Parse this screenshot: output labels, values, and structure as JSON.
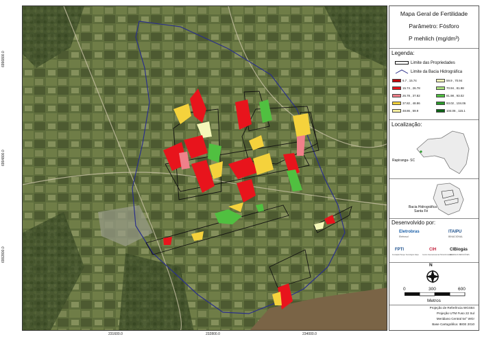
{
  "title": {
    "line1": "Mapa Geral de Fertilidade",
    "line2": "Parâmetro: Fósforo",
    "line3": "P mehlich (mg/dm³)"
  },
  "axes": {
    "y_ticks": [
      "6996800.0",
      "6994800.0",
      "6992800.0"
    ],
    "x_ticks": [
      "231600.0",
      "232800.0",
      "234000.0"
    ]
  },
  "legend": {
    "heading": "Legenda:",
    "property_limit": "Limite das Propriedades",
    "basin_limit": "Limite da Bacia Hidrográfica",
    "classes": [
      {
        "label": "6.7 , 15.74",
        "color": "#c0000a"
      },
      {
        "label": "15.74 , 26.78",
        "color": "#e8141c"
      },
      {
        "label": "26.78 , 37.82",
        "color": "#f0808a"
      },
      {
        "label": "37.82 , 48.86",
        "color": "#f5d23c"
      },
      {
        "label": "48.86 , 59.9",
        "color": "#f7f0a0"
      },
      {
        "label": "59.9 , 70.94",
        "color": "#f4f7b8"
      },
      {
        "label": "70.94 , 81.98",
        "color": "#a8e07c"
      },
      {
        "label": "81.98 , 93.02",
        "color": "#50c040"
      },
      {
        "label": "93.02 , 104.06",
        "color": "#2a9a2a"
      },
      {
        "label": "104.06 , 115.1",
        "color": "#0e6418"
      }
    ]
  },
  "location": {
    "heading": "Localização:",
    "city": "Rapiranga- SC"
  },
  "basin": {
    "label_line1": "Bacia Hidrográfica",
    "label_line2": "Santa Fé"
  },
  "developed_by": {
    "heading": "Desenvolvido por:",
    "logos": [
      {
        "name": "Eletrobras",
        "sub": "Eletrosul",
        "color": "#1a5fa8"
      },
      {
        "name": "ITAIPU",
        "sub": "BINACIONAL",
        "color": "#1b4f8c"
      },
      {
        "name": "FPTI",
        "sub": "Fundação Parque Tecnológico Itaipu",
        "color": "#1b4f8c"
      },
      {
        "name": "CIH",
        "sub": "Centro Internacional de Hidroinformática",
        "color": "#c21e3a"
      },
      {
        "name": "CIBiogás",
        "sub": "ENERGIAS RENOVÁVEIS",
        "color": "#1b1b1b"
      }
    ]
  },
  "scale": {
    "north": "N",
    "v0": "0",
    "v1": "300",
    "v2": "600",
    "unit": "Metros"
  },
  "credits": {
    "l1": "Projeção de Referência WGS84",
    "l2": "Projeção UTM Fuso 22 Sul",
    "l3": "Meridiano Central 54° WGr",
    "l4": "Base Cartográfica: IBGE 2010"
  }
}
